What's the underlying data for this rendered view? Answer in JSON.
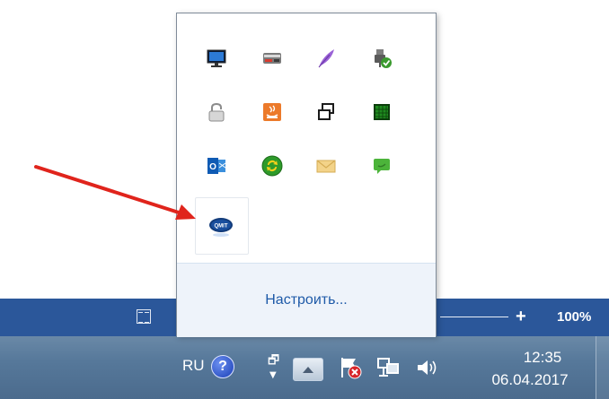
{
  "statusbar": {
    "zoom_plus": "+",
    "zoom_percent": "100%"
  },
  "tray_popup": {
    "customize_label": "Настроить...",
    "icons": [
      "display-icon",
      "card-reader-icon",
      "feather-icon",
      "usb-plug-check-icon",
      "padlock-icon",
      "java-icon",
      "windows-overlap-icon",
      "green-chip-icon",
      "outlook-icon",
      "sync-arrows-icon",
      "envelope-icon",
      "green-chat-icon",
      "qimt-icon"
    ],
    "qimt_icon_text": "QMIT"
  },
  "taskbar": {
    "language": "RU",
    "help_glyph": "?",
    "restore_glyph": "🗗",
    "down_glyph": "▼",
    "time": "12:35",
    "date": "06.04.2017"
  },
  "colors": {
    "statusbar": "#2b579a",
    "taskbar": "#5a7c9e",
    "link": "#1e5aa8",
    "arrow": "#e0241c"
  }
}
